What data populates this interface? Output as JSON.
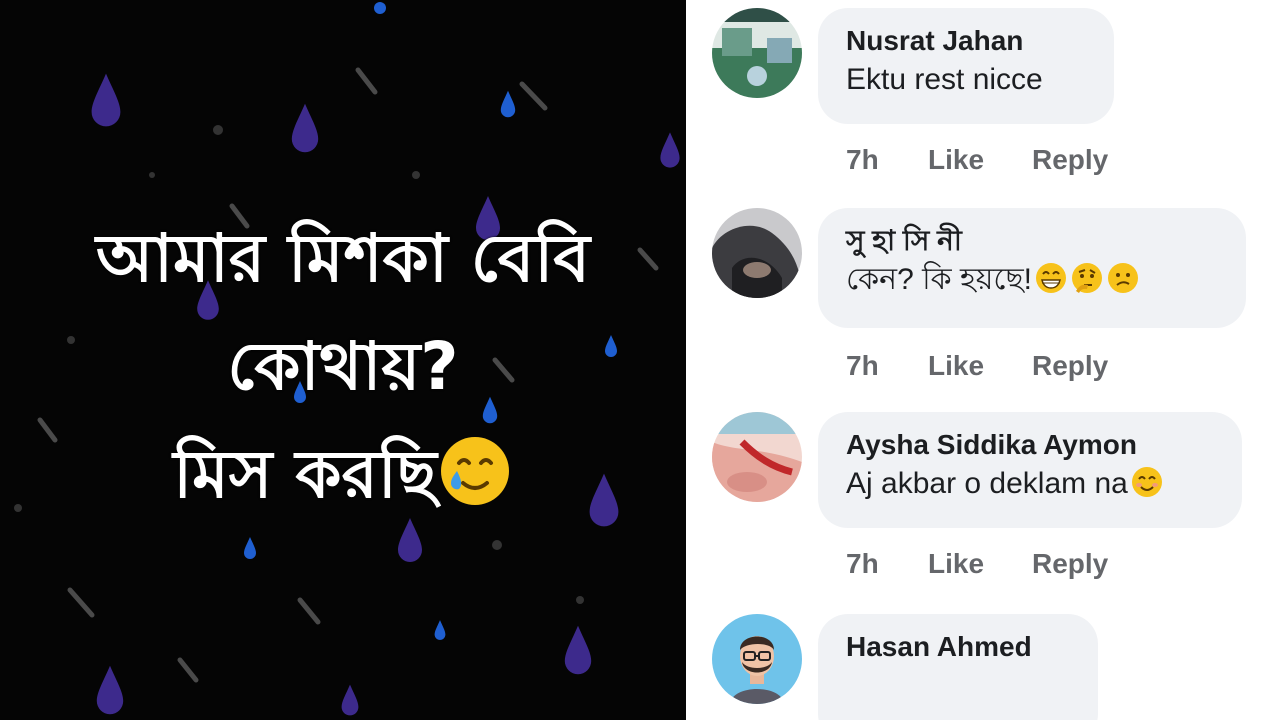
{
  "post": {
    "caption_line1": "আমার মিশকা বেবি",
    "caption_line2": "কোথায়?",
    "caption_line3": "মিস করছি"
  },
  "colors": {
    "post_background": "#050505",
    "raindrop_purple": "#3d2a8c",
    "raindrop_blue": "#1f5fd1",
    "bubble_background": "#f0f2f5",
    "meta_text": "#65676b"
  },
  "comments": [
    {
      "author": "Nusrat Jahan",
      "text": "Ektu rest nicce",
      "emojis": [],
      "time": "7h",
      "like_label": "Like",
      "reply_label": "Reply",
      "avatar_icon": "landscape-photo-avatar"
    },
    {
      "author": "সু হা সি নী",
      "text": "কেন? কি হয়ছে!",
      "emojis": [
        "grinning-face-icon",
        "thinking-face-icon",
        "confused-face-icon"
      ],
      "time": "7h",
      "like_label": "Like",
      "reply_label": "Reply",
      "avatar_icon": "hooded-person-avatar"
    },
    {
      "author": "Aysha Siddika Aymon",
      "text": "Aj akbar o deklam na",
      "emojis": [
        "smiling-face-icon"
      ],
      "time": "7h",
      "like_label": "Like",
      "reply_label": "Reply",
      "avatar_icon": "hand-photo-avatar"
    },
    {
      "author": "Hasan Ahmed",
      "text": "",
      "emojis": [],
      "avatar_icon": "cartoon-man-avatar"
    }
  ]
}
